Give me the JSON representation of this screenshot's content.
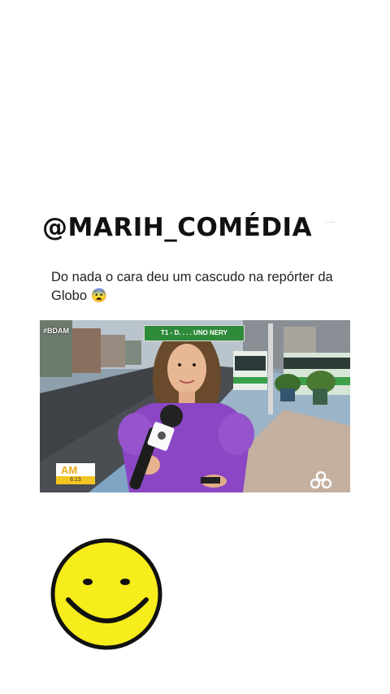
{
  "post": {
    "handle": "@MARIH_COMÉDIA",
    "more_label": "...",
    "caption": "Do nada o cara deu um cascudo na repórter da Globo 😨"
  },
  "video": {
    "corner_tag": "#BDAM",
    "street_sign": "T1 - D. . . . UNO NERY",
    "logo_text": "AM",
    "time": "6:13",
    "brand_icon": "globo-network-icon"
  },
  "sticker": {
    "icon": "smiley-face-icon",
    "color": "#f7ec1c"
  }
}
